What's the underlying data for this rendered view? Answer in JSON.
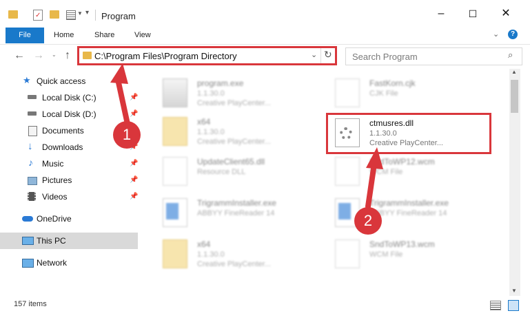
{
  "window": {
    "title": "Program",
    "minimize": "–",
    "maximize": "☐",
    "close": "✕",
    "help": "?"
  },
  "ribbon": {
    "tabs": [
      "File",
      "Home",
      "Share",
      "View"
    ]
  },
  "address": {
    "path": "C:\\Program Files\\Program Directory"
  },
  "search": {
    "placeholder": "Search Program"
  },
  "sidebar": {
    "items": [
      {
        "label": "Quick access",
        "icon": "star-icon",
        "pinned": false
      },
      {
        "label": "Local Disk (C:)",
        "icon": "drive-icon",
        "pinned": true
      },
      {
        "label": "Local Disk (D:)",
        "icon": "drive-icon",
        "pinned": true
      },
      {
        "label": "Documents",
        "icon": "documents-icon",
        "pinned": true
      },
      {
        "label": "Downloads",
        "icon": "download-icon",
        "pinned": true
      },
      {
        "label": "Music",
        "icon": "music-icon",
        "pinned": true
      },
      {
        "label": "Pictures",
        "icon": "pictures-icon",
        "pinned": true
      },
      {
        "label": "Videos",
        "icon": "videos-icon",
        "pinned": true
      },
      {
        "label": "OneDrive",
        "icon": "cloud-icon",
        "pinned": false
      },
      {
        "label": "This PC",
        "icon": "computer-icon",
        "pinned": false,
        "selected": true
      },
      {
        "label": "Network",
        "icon": "network-icon",
        "pinned": false
      }
    ]
  },
  "files": [
    {
      "name": "program.exe",
      "version": "1.1.30.0",
      "desc": "Creative PlayCenter...",
      "blurred": true
    },
    {
      "name": "FastKorn.cjk",
      "version": "CJK File",
      "desc": "",
      "blurred": true
    },
    {
      "name": "x64",
      "version": "1.1.30.0",
      "desc": "Creative PlayCenter...",
      "blurred": true
    },
    {
      "name": "ctmusres.dll",
      "version": "1.1.30.0",
      "desc": "Creative PlayCenter...",
      "blurred": false
    },
    {
      "name": "UpdateClient65.dll",
      "version": "Resource DLL",
      "desc": "",
      "blurred": true
    },
    {
      "name": "SndToWP12.wcm",
      "version": "WCM File",
      "desc": "",
      "blurred": true
    },
    {
      "name": "TrigrammInstaller.exe",
      "version": "ABBYY FineReader 14",
      "desc": "",
      "blurred": true
    },
    {
      "name": "TrigrammInstaller.exe",
      "version": "ABBYY FineReader 14",
      "desc": "",
      "blurred": true
    },
    {
      "name": "x64",
      "version": "1.1.30.0",
      "desc": "Creative PlayCenter...",
      "blurred": true
    },
    {
      "name": "SndToWP13.wcm",
      "version": "WCM File",
      "desc": "",
      "blurred": true
    }
  ],
  "status": {
    "count": "157 items"
  },
  "callouts": [
    "1",
    "2"
  ],
  "colors": {
    "accent": "#1979ca",
    "highlight": "#d9363b",
    "selection": "#d9d9d9"
  }
}
